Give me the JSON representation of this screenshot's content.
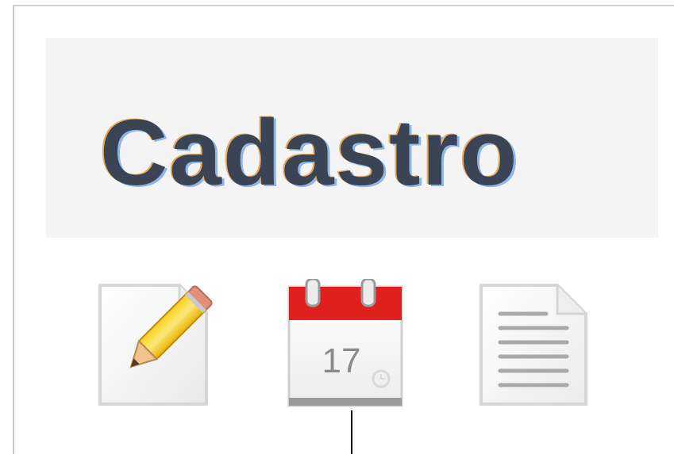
{
  "header": {
    "title": "Cadastro"
  },
  "toolbar": {
    "items": [
      {
        "icon": "pencil-icon",
        "action": "edit"
      },
      {
        "icon": "calendar-icon",
        "day_number": "17"
      },
      {
        "icon": "document-icon",
        "action": "document"
      }
    ]
  },
  "colors": {
    "title_text": "#3a4454",
    "header_background": "#f4f4f4",
    "calendar_red": "#e0201c"
  }
}
